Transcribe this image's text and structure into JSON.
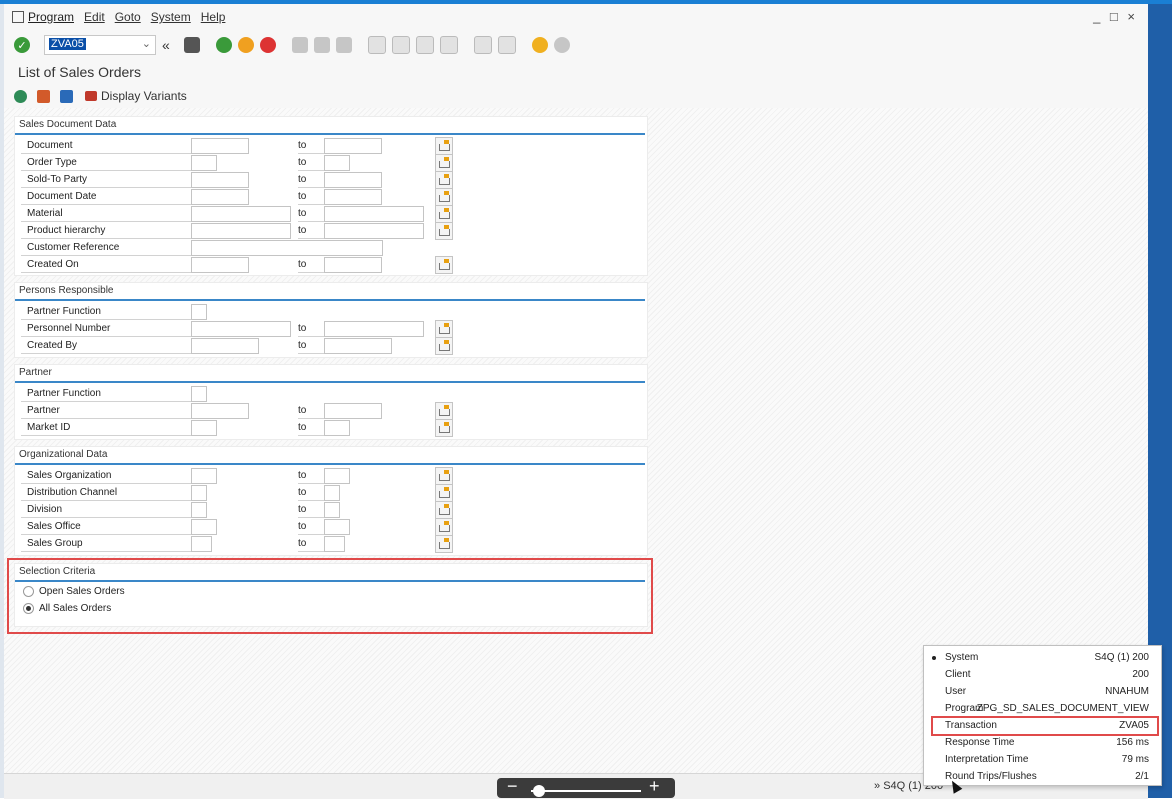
{
  "menubar": {
    "items": [
      "Program",
      "Edit",
      "Goto",
      "System",
      "Help"
    ],
    "window_controls": "_ □ ×"
  },
  "toolbar": {
    "command_value": "ZVA05"
  },
  "title": "List of Sales Orders",
  "app_toolbar": {
    "display_variants_label": "Display Variants"
  },
  "groups": {
    "sales_document_data": {
      "title": "Sales Document Data",
      "rows": [
        "Document",
        "Order Type",
        "Sold-To Party",
        "Document Date",
        "Material",
        "Product hierarchy",
        "Customer Reference",
        "Created On"
      ]
    },
    "persons_responsible": {
      "title": "Persons Responsible",
      "rows": [
        "Partner Function",
        "Personnel Number",
        "Created By"
      ]
    },
    "partner": {
      "title": "Partner",
      "rows": [
        "Partner Function",
        "Partner",
        "Market ID"
      ]
    },
    "organizational_data": {
      "title": "Organizational Data",
      "rows": [
        "Sales Organization",
        "Distribution Channel",
        "Division",
        "Sales Office",
        "Sales Group"
      ]
    },
    "selection_criteria": {
      "title": "Selection Criteria",
      "options": [
        "Open Sales Orders",
        "All Sales Orders"
      ],
      "selected": "All Sales Orders"
    }
  },
  "to_label": "to",
  "status_popup": {
    "rows": [
      {
        "key": "System",
        "value": "S4Q (1) 200"
      },
      {
        "key": "Client",
        "value": "200"
      },
      {
        "key": "User",
        "value": "NNAHUM"
      },
      {
        "key": "Program",
        "value": "ZPG_SD_SALES_DOCUMENT_VIEW"
      },
      {
        "key": "Transaction",
        "value": "ZVA05"
      },
      {
        "key": "Response Time",
        "value": "156 ms"
      },
      {
        "key": "Interpretation Time",
        "value": "79 ms"
      },
      {
        "key": "Round Trips/Flushes",
        "value": "2/1"
      }
    ]
  },
  "statusbar": {
    "text": "S4Q (1) 200"
  },
  "colors": {
    "accent_blue": "#1a7fd4",
    "highlight_red": "#e04a4a"
  }
}
